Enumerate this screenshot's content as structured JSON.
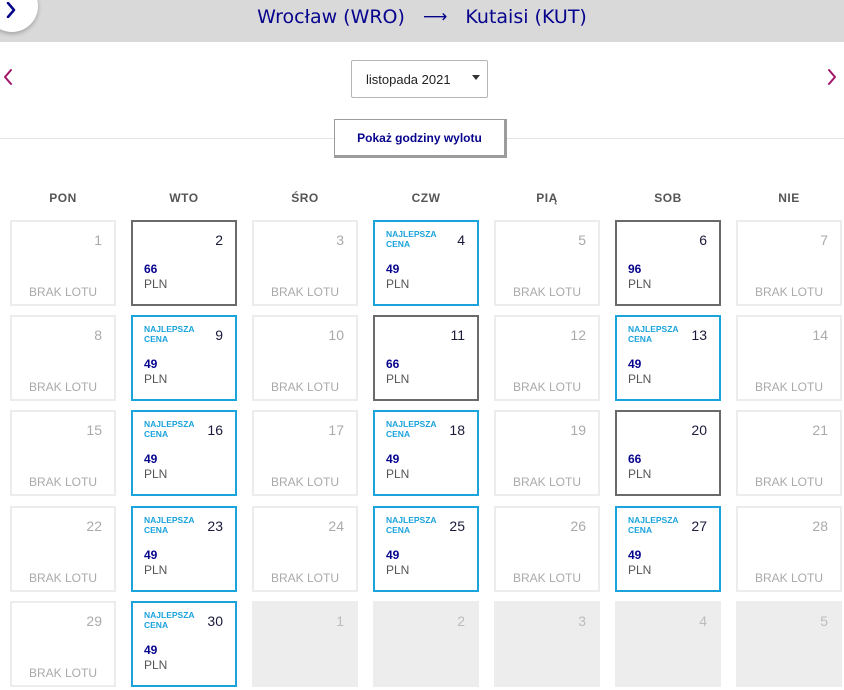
{
  "header": {
    "origin": "Wrocław (WRO)",
    "destination": "Kutaisi (KUT)",
    "text_color": "#06038d",
    "bar_color": "#d9d9d9"
  },
  "navigation": {
    "back_icon": "chevron-left-icon",
    "prev_icon": "chevron-left-icon",
    "next_icon": "chevron-right-icon",
    "arrow_color": "#a0146a"
  },
  "month_select": {
    "value": "listopada 2021"
  },
  "toggle_button": {
    "label": "Pokaż godziny wylotu"
  },
  "weekdays": [
    "PON",
    "WTO",
    "ŚRO",
    "CZW",
    "PIĄ",
    "SOB",
    "NIE"
  ],
  "labels": {
    "no_flight": "BRAK LOTU",
    "best_price": "NAJLEPSZA CENA",
    "currency": "PLN"
  },
  "colors": {
    "best_border": "#1ba3dc",
    "priced_border": "#6a6a6a",
    "empty_border": "#ececec",
    "next_month_bg": "#ededed"
  },
  "days": [
    {
      "day": 1,
      "type": "none"
    },
    {
      "day": 2,
      "type": "price",
      "price": "66"
    },
    {
      "day": 3,
      "type": "none"
    },
    {
      "day": 4,
      "type": "best",
      "price": "49"
    },
    {
      "day": 5,
      "type": "none"
    },
    {
      "day": 6,
      "type": "price",
      "price": "96"
    },
    {
      "day": 7,
      "type": "none"
    },
    {
      "day": 8,
      "type": "none"
    },
    {
      "day": 9,
      "type": "best",
      "price": "49"
    },
    {
      "day": 10,
      "type": "none"
    },
    {
      "day": 11,
      "type": "price",
      "price": "66"
    },
    {
      "day": 12,
      "type": "none"
    },
    {
      "day": 13,
      "type": "best",
      "price": "49"
    },
    {
      "day": 14,
      "type": "none"
    },
    {
      "day": 15,
      "type": "none"
    },
    {
      "day": 16,
      "type": "best",
      "price": "49"
    },
    {
      "day": 17,
      "type": "none"
    },
    {
      "day": 18,
      "type": "best",
      "price": "49"
    },
    {
      "day": 19,
      "type": "none"
    },
    {
      "day": 20,
      "type": "price",
      "price": "66"
    },
    {
      "day": 21,
      "type": "none"
    },
    {
      "day": 22,
      "type": "none"
    },
    {
      "day": 23,
      "type": "best",
      "price": "49"
    },
    {
      "day": 24,
      "type": "none"
    },
    {
      "day": 25,
      "type": "best",
      "price": "49"
    },
    {
      "day": 26,
      "type": "none"
    },
    {
      "day": 27,
      "type": "best",
      "price": "49"
    },
    {
      "day": 28,
      "type": "none"
    },
    {
      "day": 29,
      "type": "none"
    },
    {
      "day": 30,
      "type": "best",
      "price": "49"
    },
    {
      "day": 1,
      "type": "next"
    },
    {
      "day": 2,
      "type": "next"
    },
    {
      "day": 3,
      "type": "next"
    },
    {
      "day": 4,
      "type": "next"
    },
    {
      "day": 5,
      "type": "next"
    }
  ]
}
